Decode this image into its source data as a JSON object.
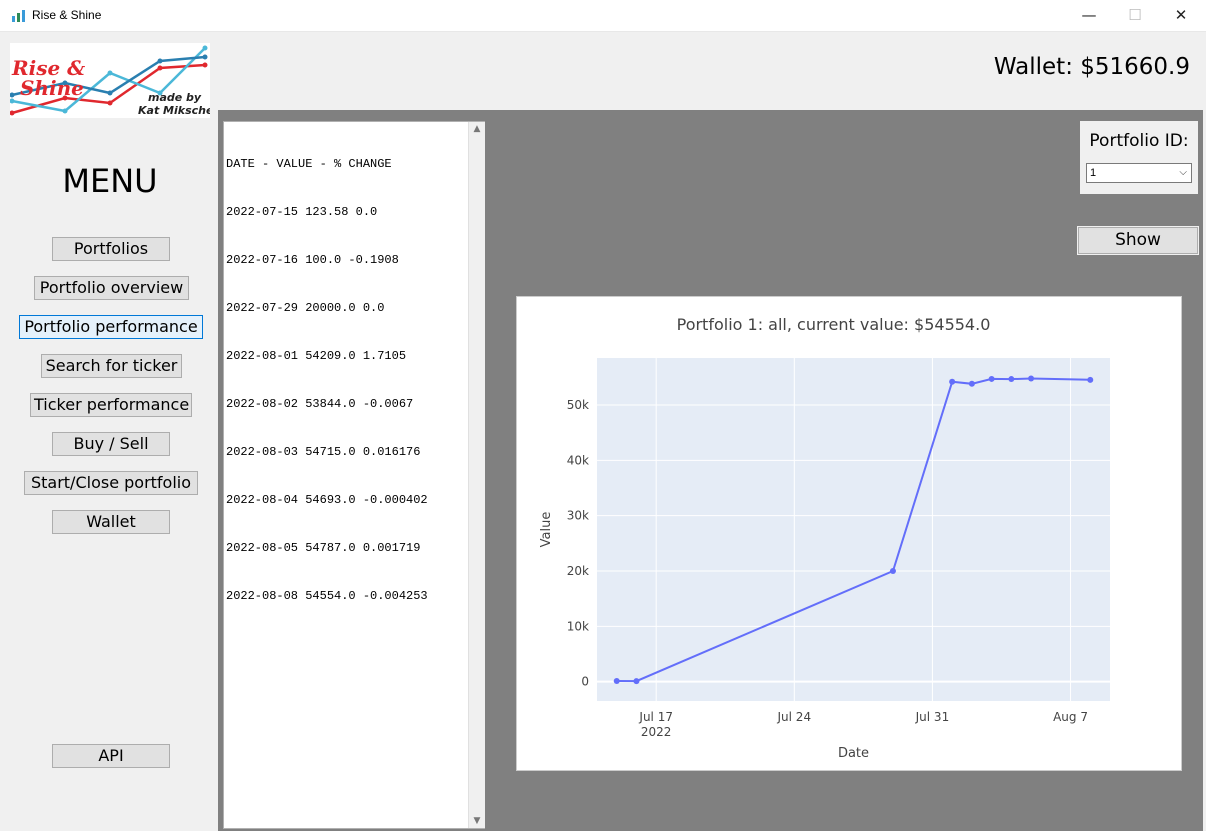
{
  "window": {
    "title": "Rise & Shine",
    "min_glyph": "—",
    "max_glyph": "☐",
    "close_glyph": "✕"
  },
  "logo": {
    "line1": "Rise &",
    "line2": "Shine",
    "byline1": "made by",
    "byline2": "Kat Miksche"
  },
  "header": {
    "wallet_label": "Wallet: $51660.9"
  },
  "sidebar": {
    "title": "MENU",
    "items": [
      {
        "label": "Portfolios"
      },
      {
        "label": "Portfolio overview"
      },
      {
        "label": "Portfolio performance"
      },
      {
        "label": "Search for ticker"
      },
      {
        "label": "Ticker performance"
      },
      {
        "label": "Buy / Sell"
      },
      {
        "label": "Start/Close portfolio"
      },
      {
        "label": "Wallet"
      }
    ],
    "api_label": "API"
  },
  "listbox": {
    "header": "DATE - VALUE - % CHANGE",
    "rows": [
      "2022-07-15 123.58 0.0",
      "2022-07-16 100.0 -0.1908",
      "2022-07-29 20000.0 0.0",
      "2022-08-01 54209.0 1.7105",
      "2022-08-02 53844.0 -0.0067",
      "2022-08-03 54715.0 0.016176",
      "2022-08-04 54693.0 -0.000402",
      "2022-08-05 54787.0 0.001719",
      "2022-08-08 54554.0 -0.004253"
    ]
  },
  "controls": {
    "portfolio_id_label": "Portfolio ID:",
    "portfolio_id_value": "1",
    "show_label": "Show"
  },
  "chart_data": {
    "type": "line",
    "title": "Portfolio 1: all, current value: $54554.0",
    "xlabel": "Date",
    "ylabel": "Value",
    "x": [
      "2022-07-15",
      "2022-07-16",
      "2022-07-29",
      "2022-08-01",
      "2022-08-02",
      "2022-08-03",
      "2022-08-04",
      "2022-08-05",
      "2022-08-08"
    ],
    "y": [
      123.58,
      100.0,
      20000.0,
      54209.0,
      53844.0,
      54715.0,
      54693.0,
      54787.0,
      54554.0
    ],
    "xlim": [
      "2022-07-14",
      "2022-08-09"
    ],
    "ylim": [
      -3500,
      58500
    ],
    "x_ticks": [
      {
        "date": "2022-07-17",
        "label": "Jul 17",
        "sublabel": "2022"
      },
      {
        "date": "2022-07-24",
        "label": "Jul 24",
        "sublabel": ""
      },
      {
        "date": "2022-07-31",
        "label": "Jul 31",
        "sublabel": ""
      },
      {
        "date": "2022-08-07",
        "label": "Aug 7",
        "sublabel": ""
      }
    ],
    "y_ticks": [
      {
        "value": 0,
        "label": "0"
      },
      {
        "value": 10000,
        "label": "10k"
      },
      {
        "value": 20000,
        "label": "20k"
      },
      {
        "value": 30000,
        "label": "30k"
      },
      {
        "value": 40000,
        "label": "40k"
      },
      {
        "value": 50000,
        "label": "50k"
      }
    ],
    "grid": true,
    "line_color": "#636efa",
    "plot_bg": "#e5ecf6"
  }
}
